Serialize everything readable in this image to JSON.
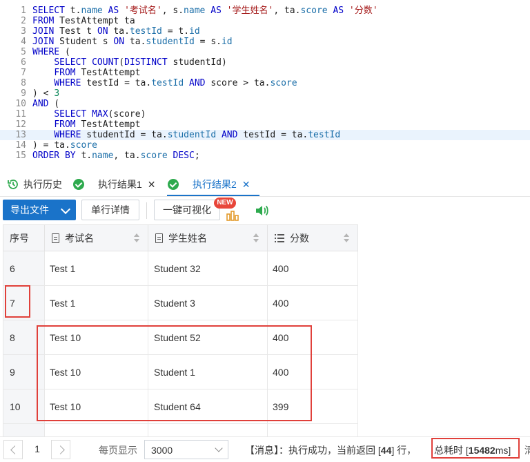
{
  "editor": {
    "lines": [
      {
        "n": "1"
      },
      {
        "n": "2"
      },
      {
        "n": "3"
      },
      {
        "n": "4"
      },
      {
        "n": "5"
      },
      {
        "n": "6"
      },
      {
        "n": "7"
      },
      {
        "n": "8"
      },
      {
        "n": "9"
      },
      {
        "n": "10"
      },
      {
        "n": "11"
      },
      {
        "n": "12"
      },
      {
        "n": "13"
      },
      {
        "n": "14"
      },
      {
        "n": "15"
      }
    ],
    "tokens": {
      "select": "SELECT",
      "from": "FROM",
      "join": "JOIN",
      "on": "ON",
      "as": "AS",
      "where": "WHERE",
      "and": "AND",
      "order": "ORDER",
      "by": "BY",
      "desc": "DESC",
      "count": "COUNT",
      "distinct": "DISTINCT",
      "max": "MAX",
      "t": "t",
      "s": "s",
      "ta": "ta",
      "name": "name",
      "score": "score",
      "testId": "testId",
      "studentId": "studentId",
      "id": "id",
      "TestAttempt": "TestAttempt",
      "Test": "Test",
      "Student": "Student",
      "lit_exam": "'考试名'",
      "lit_student": "'学生姓名'",
      "lit_score": "'分数'",
      "num3": "3"
    }
  },
  "tabs": [
    {
      "label": "执行历史",
      "icon": "history-icon"
    },
    {
      "label": "执行结果1",
      "icon": "success-check-icon"
    },
    {
      "label": "执行结果2",
      "icon": "success-check-icon",
      "active": true
    }
  ],
  "toolbar": {
    "export_label": "导出文件",
    "detail_label": "单行详情",
    "visualize_label": "一键可视化",
    "new_badge": "NEW",
    "icons": [
      "magic-chart-icon",
      "speaker-icon"
    ]
  },
  "table": {
    "columns": [
      {
        "label": "序号"
      },
      {
        "label": "考试名",
        "icon": "document-icon"
      },
      {
        "label": "学生姓名",
        "icon": "document-icon"
      },
      {
        "label": "分数",
        "icon": "list-number-icon"
      }
    ],
    "rows": [
      {
        "idx": "6",
        "exam": "Test 1",
        "student": "Student 32",
        "score": "400"
      },
      {
        "idx": "7",
        "exam": "Test 1",
        "student": "Student 3",
        "score": "400"
      },
      {
        "idx": "8",
        "exam": "Test 10",
        "student": "Student 52",
        "score": "400"
      },
      {
        "idx": "9",
        "exam": "Test 10",
        "student": "Student 1",
        "score": "400"
      },
      {
        "idx": "10",
        "exam": "Test 10",
        "student": "Student 64",
        "score": "399"
      }
    ]
  },
  "footer": {
    "page": "1",
    "per_page_label": "每页显示",
    "per_page_value": "3000",
    "msg_prefix": "【消息】：执行成功，当前返回 [",
    "rows_returned": "44",
    "msg_mid": "] 行，",
    "time_label": "总耗时 [",
    "time_value": "15482",
    "time_unit": "ms]",
    "trail": "清"
  },
  "colors": {
    "accent": "#1a73c9",
    "annotation": "#e0403a",
    "success": "#2eaa4e"
  }
}
